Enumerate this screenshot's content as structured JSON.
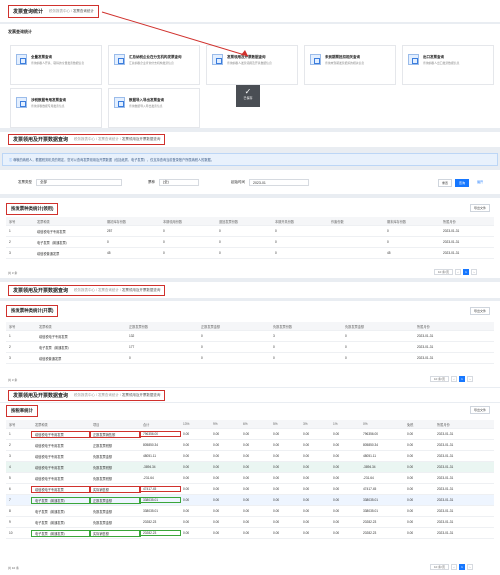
{
  "page1": {
    "title": "发票查询统计",
    "crumbs": [
      "税务报表中心",
      "发票查询统计"
    ],
    "group_title": "发票查询统计",
    "cards": [
      {
        "title": "全量发票查询",
        "desc": "查询纳税人开具、取得的全量发票数据信息"
      },
      {
        "title": "汇总纳税企业在分支机构发票查询",
        "desc": "汇总纳税企业查询分支机构发票信息"
      },
      {
        "title": "发票领用及开票数据查询",
        "desc": "查询纳税人发票领用及开具数据信息"
      },
      {
        "title": "未到期票抵扣相关查询",
        "desc": "查询未到期发票抵扣的相关信息"
      },
      {
        "title": "出口发票查询",
        "desc": "查询纳税人出口发票数据信息"
      },
      {
        "title": "涉税数据专用发票查询",
        "desc": "查询涉税数据专用发票信息"
      },
      {
        "title": "数据导入导出发票查询",
        "desc": "查询数据导入导出发票信息"
      }
    ],
    "dock_label": "已保存"
  },
  "page2": {
    "title": "发票领用及开票数据查询",
    "crumbs": [
      "税务报表中心",
      "发票查询统计",
      "发票领用及开票数据查询"
    ],
    "notice": "尊敬的纳税人，根据税务机关的规定，您可以查询发票领用及开票数据（包括纸质、电子发票），仅支持查询当前登录账户所属纳税人的数据。",
    "filters": {
      "label1": "发票类型",
      "value1": "全部",
      "label2": "票种",
      "value2": "(全)",
      "label3": "起始时间",
      "value3": "2023-01"
    },
    "btn_reset": "重置",
    "btn_query": "查询",
    "btn_expand": "展开",
    "section_title": "按发票种类统计(领用)",
    "export_label": "导出文件",
    "headers": [
      "序号",
      "发票种类",
      "期初库存份数",
      "本期领用份数",
      "退回发票份数",
      "本期开具份数",
      "作废份数",
      "期末库存份数",
      "所属月份"
    ],
    "rows": [
      [
        "1",
        "增值税电子专用发票",
        "257",
        "0",
        "0",
        "0",
        "",
        "0",
        "2023-01-31"
      ],
      [
        "2",
        "电子发票（普通发票）",
        "0",
        "0",
        "0",
        "0",
        "",
        "0",
        "2023-01-31"
      ],
      [
        "3",
        "增值税普通发票",
        "45",
        "0",
        "0",
        "0",
        "",
        "45",
        "2023-01-31"
      ]
    ],
    "total": "共 3 条",
    "page_size": "10 条/页",
    "page_no": "1"
  },
  "page3": {
    "title": "发票领用及开票数据查询",
    "crumbs": [
      "税务报表中心",
      "发票查询统计",
      "发票领用及开票数据查询"
    ],
    "section_title": "按发票种类统计(开票)",
    "export_label": "导出文件",
    "headers": [
      "序号",
      "发票种类",
      "正数发票份数",
      "正数发票金额",
      "负数发票份数",
      "负数发票金额",
      "所属月份"
    ],
    "rows": [
      [
        "1",
        "增值税电子专用发票",
        "132",
        "0",
        "3",
        "0",
        "2023-01-31"
      ],
      [
        "2",
        "电子发票（普通发票）",
        "177",
        "0",
        "0",
        "0",
        "2023-01-31"
      ],
      [
        "3",
        "增值税普通发票",
        "0",
        "0",
        "0",
        "0",
        "2023-01-31"
      ]
    ],
    "total": "共 3 条",
    "page_size": "10 条/页",
    "page_no": "1"
  },
  "page4": {
    "title": "发票领用及开票数据查询",
    "crumbs": [
      "税务报表中心",
      "发票查询统计",
      "发票领用及开票数据查询"
    ],
    "section_title": "按税率统计",
    "export_label": "导出文件",
    "headers": [
      "序号",
      "发票种类",
      "项目",
      "合计",
      "13%",
      "9%",
      "6%",
      "5%",
      "3%",
      "1%",
      "0%",
      "免税",
      "所属月份"
    ],
    "rows": [
      {
        "c": [
          "1",
          "增值税电子专用发票",
          "正数发票销售额",
          "796356.00",
          "0.00",
          "0.00",
          "0.00",
          "0.00",
          "0.00",
          "0.00",
          "796356.00",
          "0.00",
          "2023-01-31"
        ],
        "red": true
      },
      {
        "c": [
          "2",
          "增值税电子专用发票",
          "正数发票税额",
          "805850.34",
          "0.00",
          "0.00",
          "0.00",
          "0.00",
          "0.00",
          "0.00",
          "805850.34",
          "0.00",
          "2023-01-31"
        ]
      },
      {
        "c": [
          "3",
          "增值税电子专用发票",
          "负数发票金额",
          "48051.11",
          "0.00",
          "0.00",
          "0.00",
          "0.00",
          "0.00",
          "0.00",
          "48051.11",
          "0.00",
          "2023-01-31"
        ]
      },
      {
        "c": [
          "4",
          "增值税电子专用发票",
          "负数发票税额",
          "-3894.34",
          "0.00",
          "0.00",
          "0.00",
          "0.00",
          "0.00",
          "0.00",
          "-3894.34",
          "0.00",
          "2023-01-31"
        ],
        "hl": true
      },
      {
        "c": [
          "5",
          "增值税电子专用发票",
          "负数发票税额",
          "-231.64",
          "0.00",
          "0.00",
          "0.00",
          "0.00",
          "0.00",
          "0.00",
          "-231.64",
          "0.00",
          "2023-01-31"
        ]
      },
      {
        "c": [
          "6",
          "增值税电子专用发票",
          "实际销售额",
          "47417.45",
          "0.00",
          "0.00",
          "0.00",
          "0.00",
          "0.00",
          "0.00",
          "47417.45",
          "0.00",
          "2023-01-31"
        ],
        "red": true
      },
      {
        "c": [
          "7",
          "电子发票（普通发票）",
          "正数发票金额",
          "338035.01",
          "0.00",
          "0.00",
          "0.00",
          "0.00",
          "0.00",
          "0.00",
          "338035.01",
          "0.00",
          "2023-01-31"
        ],
        "green": true,
        "blue": true
      },
      {
        "c": [
          "8",
          "电子发票（普通发票）",
          "负数发票金额",
          "338035.01",
          "0.00",
          "0.00",
          "0.00",
          "0.00",
          "0.00",
          "0.00",
          "338035.01",
          "0.00",
          "2023-01-31"
        ]
      },
      {
        "c": [
          "9",
          "电子发票（普通发票）",
          "负数发票金额",
          "20282.23",
          "0.00",
          "0.00",
          "0.00",
          "0.00",
          "0.00",
          "0.00",
          "20282.23",
          "0.00",
          "2023-01-31"
        ]
      },
      {
        "c": [
          "10",
          "电子发票（普通发票）",
          "实际销售额",
          "20282.23",
          "0.00",
          "0.00",
          "0.00",
          "0.00",
          "0.00",
          "0.00",
          "20282.23",
          "0.00",
          "2023-01-31"
        ],
        "green": true
      }
    ],
    "total": "共 10 条",
    "page_size": "10 条/页",
    "page_no": "1"
  },
  "colors": {
    "accent": "#1677ff",
    "red": "#d0312d",
    "green": "#3aa63a"
  }
}
